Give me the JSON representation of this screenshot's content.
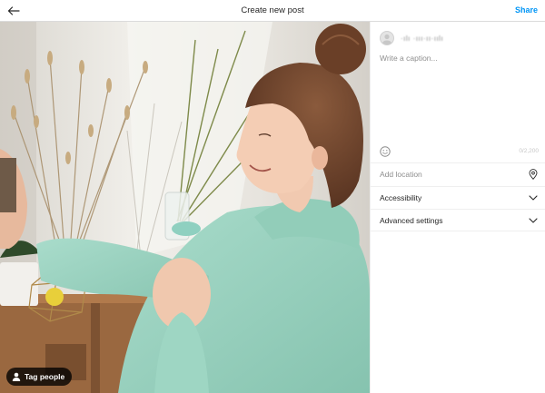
{
  "header": {
    "title": "Create new post",
    "share_label": "Share",
    "back_icon": "arrow-left-icon"
  },
  "photo": {
    "tag_people_label": "Tag people",
    "tag_icon": "person-icon"
  },
  "sidebar": {
    "username": "·ılı ·ııı·ıı·ıılı",
    "caption_placeholder": "Write a caption...",
    "char_count": "0/2,200",
    "emoji_icon": "smiley-icon",
    "add_location_placeholder": "Add location",
    "location_icon": "location-pin-icon",
    "accessibility_label": "Accessibility",
    "advanced_settings_label": "Advanced settings",
    "chevron_icon": "chevron-down-icon"
  },
  "colors": {
    "share": "#0095f6",
    "hoodie": "#9fd6c4",
    "text_primary": "#262626",
    "text_secondary": "#8e8e8e"
  }
}
